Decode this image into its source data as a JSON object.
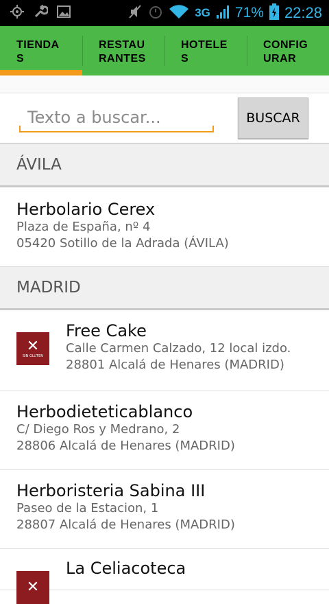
{
  "status_bar": {
    "network": "3G",
    "battery": "71%",
    "time": "22:28",
    "icons": [
      "location-icon",
      "wrench-icon",
      "image-icon",
      "mute-icon",
      "alarm-icon",
      "wifi-icon",
      "signal-icon",
      "battery-icon"
    ]
  },
  "tabs": [
    {
      "label": "TIENDA\nS",
      "active": true
    },
    {
      "label": "RESTAU\nRANTES",
      "active": false
    },
    {
      "label": "HOTELE\nS",
      "active": false
    },
    {
      "label": "CONFIG\nURAR",
      "active": false
    }
  ],
  "search": {
    "placeholder": "Texto a buscar...",
    "value": "",
    "button_label": "BUSCAR"
  },
  "sections": [
    {
      "title": "ÁVILA",
      "items": [
        {
          "name": "Herbolario Cerex",
          "line1": "Plaza de España, nº 4",
          "line2": "05420 Sotillo de la Adrada (ÁVILA)"
        }
      ]
    },
    {
      "title": "MADRID",
      "items": [
        {
          "name": "Free Cake",
          "line1": "Calle Carmen Calzado, 12 local izdo.",
          "line2": "28801 Alcalá de Henares (MADRID)",
          "logo_text": "SIN GLUTEN"
        },
        {
          "name": "Herbodieteticablanco",
          "line1": "C/ Diego Ros y Medrano, 2",
          "line2": "28806 Alcalá de Henares (MADRID)"
        },
        {
          "name": "Herboristeria Sabina III",
          "line1": "Paseo de la Estacion, 1",
          "line2": "28807 Alcalá de Henares (MADRID)"
        },
        {
          "name": "La Celiacoteca"
        }
      ]
    }
  ],
  "colors": {
    "tab_bar": "#4cb848",
    "tab_indicator": "#f39a1b",
    "status_text": "#33b5e5",
    "logo_bg": "#8c1c1f"
  }
}
